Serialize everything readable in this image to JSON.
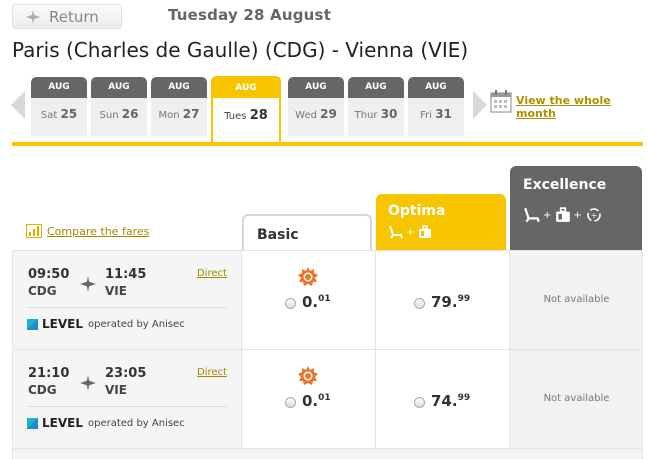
{
  "header": {
    "return_label": "Return",
    "date_label": "Tuesday 28 August",
    "route_title": "Paris (Charles de Gaulle) (CDG) - Vienna (VIE)"
  },
  "date_strip": {
    "days": [
      {
        "month": "AUG",
        "weekday": "Sat",
        "day": "25"
      },
      {
        "month": "AUG",
        "weekday": "Sun",
        "day": "26"
      },
      {
        "month": "AUG",
        "weekday": "Mon",
        "day": "27"
      },
      {
        "month": "AUG",
        "weekday": "Tues",
        "day": "28"
      },
      {
        "month": "AUG",
        "weekday": "Wed",
        "day": "29"
      },
      {
        "month": "AUG",
        "weekday": "Thur",
        "day": "30"
      },
      {
        "month": "AUG",
        "weekday": "Fri",
        "day": "31"
      }
    ],
    "selected_index": 3,
    "whole_month_label": "View the whole month"
  },
  "fares": {
    "compare_label": "Compare the fares",
    "columns": {
      "basic": "Basic",
      "optima": "Optima",
      "excellence": "Excellence"
    }
  },
  "flights": [
    {
      "dep_time": "09:50",
      "dep_code": "CDG",
      "arr_time": "11:45",
      "arr_code": "VIE",
      "direct_label": "Direct",
      "carrier": "LEVEL",
      "operated_by": "operated by Anisec",
      "basic_price_main": "0.",
      "basic_price_cents": "01",
      "optima_price_main": "79.",
      "optima_price_cents": "99",
      "excellence_label": "Not available"
    },
    {
      "dep_time": "21:10",
      "dep_code": "CDG",
      "arr_time": "23:05",
      "arr_code": "VIE",
      "direct_label": "Direct",
      "carrier": "LEVEL",
      "operated_by": "operated by Anisec",
      "basic_price_main": "0.",
      "basic_price_cents": "01",
      "optima_price_main": "74.",
      "optima_price_cents": "99",
      "excellence_label": "Not available"
    }
  ],
  "colors": {
    "accent": "#f7c400",
    "dark": "#666666",
    "link": "#a28a00"
  }
}
